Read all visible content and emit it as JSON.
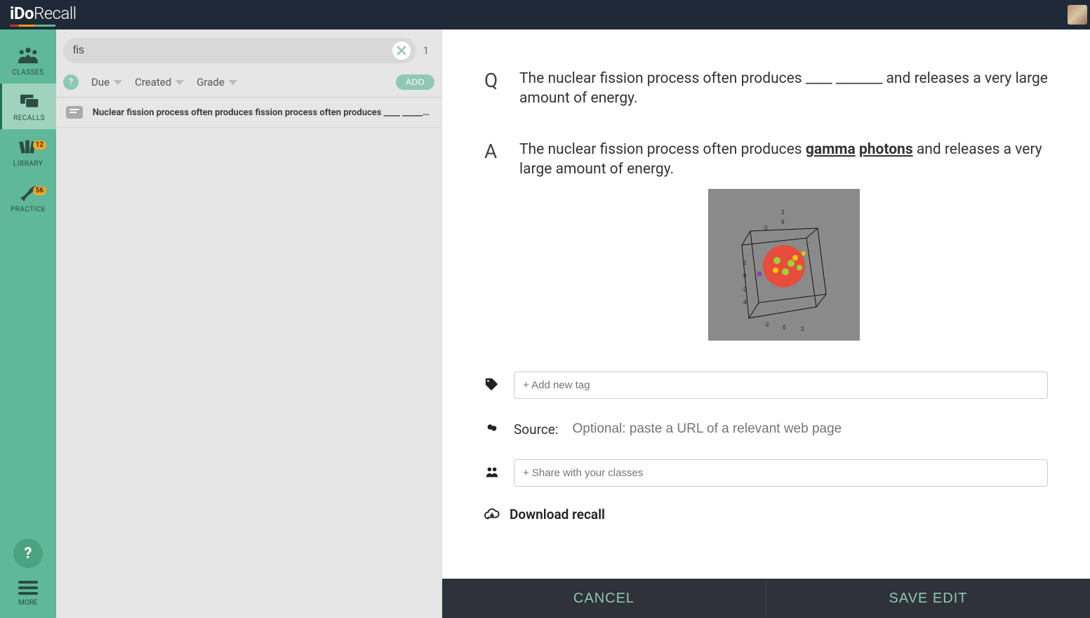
{
  "app": {
    "name_part1": "iDo",
    "name_part2": "Recall"
  },
  "sidebar": {
    "items": [
      {
        "label": "CLASSES",
        "active": false,
        "badge": null
      },
      {
        "label": "RECALLS",
        "active": true,
        "badge": null
      },
      {
        "label": "LIBRARY",
        "active": false,
        "badge": "12"
      },
      {
        "label": "PRACTICE",
        "active": false,
        "badge": "56"
      }
    ],
    "help_label": "?",
    "more_label": "MORE"
  },
  "list": {
    "search_value": "fis",
    "result_count": "1",
    "filters": [
      "Due",
      "Created",
      "Grade"
    ],
    "add_label": "ADD",
    "rows": [
      {
        "text": "Nuclear fission process often produces fission process often produces ____ ______ …"
      }
    ]
  },
  "editor": {
    "q_letter": "Q",
    "a_letter": "A",
    "question": "The nuclear fission process often produces  ____  _______  and releases a very large amount of energy.",
    "answer_pre": "The nuclear fission process often produces ",
    "answer_bold1": "gamma",
    "answer_bold_space": " ",
    "answer_bold2": "photons",
    "answer_post": " and releases a very large amount of energy.",
    "tags_placeholder": "+ Add new tag",
    "source_label": "Source:",
    "source_placeholder": "Optional: paste a URL of a relevant web page",
    "share_placeholder": "+ Share with your classes",
    "download_label": "Download recall",
    "cancel_label": "CANCEL",
    "save_label": "SAVE EDIT"
  }
}
